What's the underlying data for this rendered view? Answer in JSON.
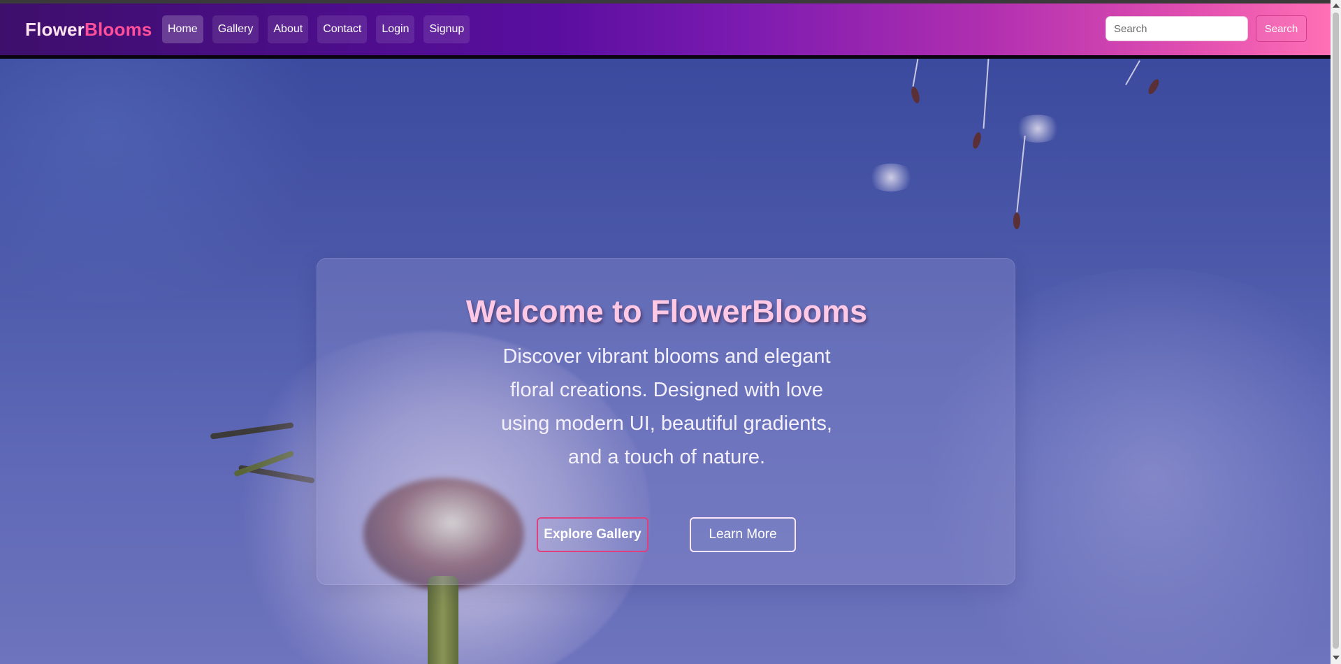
{
  "brand": {
    "part1": "Flower",
    "part2": "Blooms"
  },
  "nav": {
    "items": [
      {
        "label": "Home",
        "active": true
      },
      {
        "label": "Gallery",
        "active": false
      },
      {
        "label": "About",
        "active": false
      },
      {
        "label": "Contact",
        "active": false
      },
      {
        "label": "Login",
        "active": false
      },
      {
        "label": "Signup",
        "active": false
      }
    ]
  },
  "search": {
    "placeholder": "Search",
    "value": "",
    "button_label": "Search"
  },
  "hero": {
    "title": "Welcome to FlowerBlooms",
    "description": "Discover vibrant blooms and elegant floral creations. Designed with love using modern UI, beautiful gradients, and a touch of nature.",
    "primary_button": "Explore Gallery",
    "secondary_button": "Learn More",
    "background_icon": "dandelion-photo"
  },
  "colors": {
    "brand_accent": "#ff4f9a",
    "title_pink": "#ffc9e6",
    "nav_gradient_start": "#3e0f6b",
    "nav_gradient_end": "#ff70b5"
  }
}
